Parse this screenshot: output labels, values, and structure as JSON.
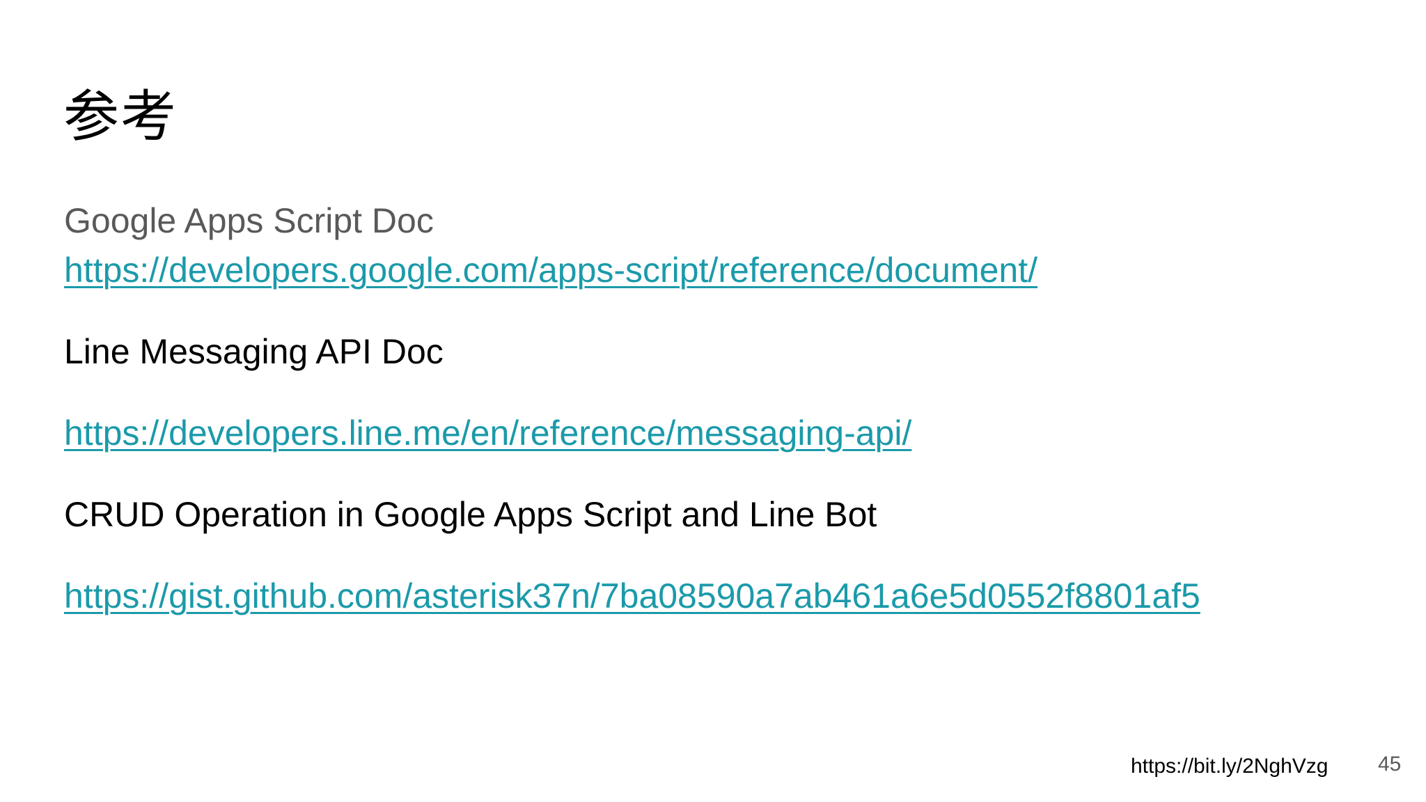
{
  "slide": {
    "title": "参考",
    "items": [
      {
        "text": "Google Apps Script Doc",
        "type": "label"
      },
      {
        "text": "https://developers.google.com/apps-script/reference/document/",
        "type": "link"
      },
      {
        "text": "Line Messaging API Doc",
        "type": "label"
      },
      {
        "text": "https://developers.line.me/en/reference/messaging-api/",
        "type": "link"
      },
      {
        "text": "CRUD Operation in Google Apps Script and Line Bot",
        "type": "label"
      },
      {
        "text": "https://gist.github.com/asterisk37n/7ba08590a7ab461a6e5d0552f8801af5",
        "type": "link"
      }
    ],
    "footer_link": "https://bit.ly/2NghVzg",
    "page_number": "45"
  },
  "colors": {
    "link": "#1b9aaa",
    "muted_text": "#595959",
    "text": "#000000",
    "background": "#ffffff"
  }
}
